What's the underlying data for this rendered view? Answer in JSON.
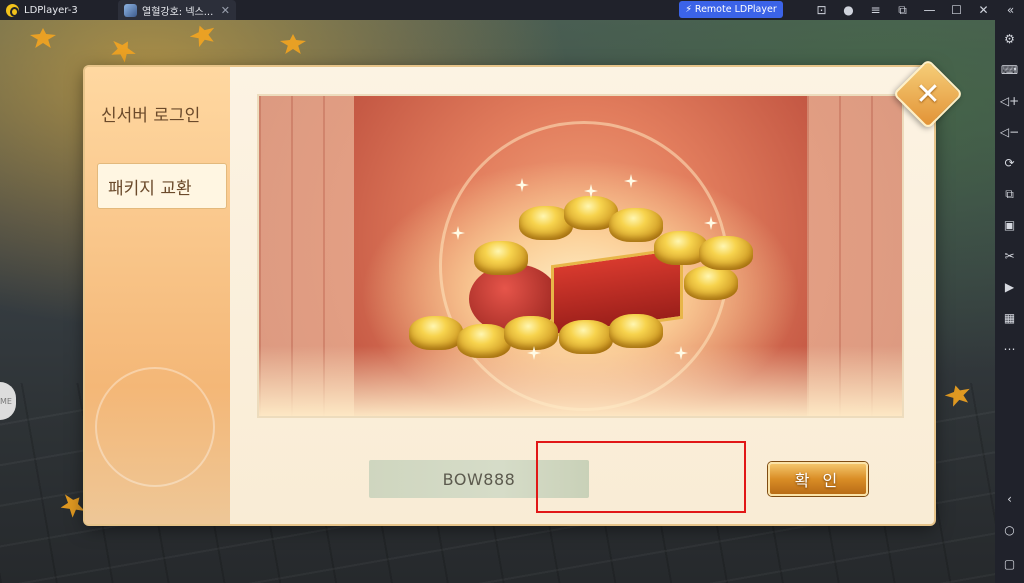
{
  "titlebar": {
    "app_tab": "LDPlayer-3",
    "game_tab": "열혈강호: 넥스...",
    "remote_button": "Remote LDPlayer"
  },
  "window_controls": [
    "gift-icon",
    "account-icon",
    "menu-icon",
    "popout-icon",
    "minimize-icon",
    "maximize-icon",
    "close-icon",
    "collapse-icon"
  ],
  "sidebar": {
    "icons": [
      "settings-icon",
      "keyboard-icon",
      "volume-up-icon",
      "volume-down-icon",
      "rotate-icon",
      "multi-instance-icon",
      "apk-icon",
      "scissors-icon",
      "record-icon",
      "more-icon"
    ],
    "bottom_icons": [
      "back-icon",
      "home-icon",
      "recents-icon"
    ]
  },
  "dialog": {
    "menu": {
      "login": "신서버 로그인",
      "package_exchange": "패키지 교환"
    },
    "code_input": {
      "value": "BOW888"
    },
    "confirm_button": "확 인",
    "close_button": "✕"
  },
  "colors": {
    "highlight": "#e11717",
    "button_gold": "#d98d26",
    "remote_blue": "#3b63e8"
  }
}
